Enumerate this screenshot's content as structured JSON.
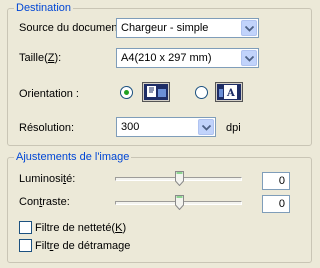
{
  "destination": {
    "legend": "Destination",
    "source_label": "Source du document",
    "source_value": "Chargeur - simple",
    "size_label_pre": "Taille(",
    "size_label_key": "Z",
    "size_label_post": "):",
    "size_value": "A4(210 x 297 mm)",
    "orientation_label": "Orientation :",
    "orientation_selected": "portrait",
    "resolution_label": "Résolution:",
    "resolution_value": "300",
    "resolution_unit": "dpi"
  },
  "adjustments": {
    "legend": "Ajustements de l'image",
    "brightness_label_pre": "Luminosi",
    "brightness_label_key": "t",
    "brightness_label_post": "é:",
    "brightness_value": "0",
    "contrast_label_pre": "Con",
    "contrast_label_key": "t",
    "contrast_label_post": "raste:",
    "contrast_value": "0",
    "sharpness_label_pre": "Filtre de netteté(",
    "sharpness_label_key": "K",
    "sharpness_label_post": ")",
    "sharpness_checked": false,
    "descreen_label_pre": "Filt",
    "descreen_label_key": "r",
    "descreen_label_post": "e de détramage",
    "descreen_checked": false
  },
  "icons": {
    "combo_arrow": "chevron-down-icon",
    "portrait": "portrait-orientation-icon",
    "landscape": "landscape-orientation-icon",
    "slider_thumb": "slider-thumb-icon"
  },
  "colors": {
    "window_bg": "#ece9d8",
    "legend_text": "#0046d5",
    "radio_dot": "#21a121",
    "combo_button": "#c1d3fb"
  }
}
